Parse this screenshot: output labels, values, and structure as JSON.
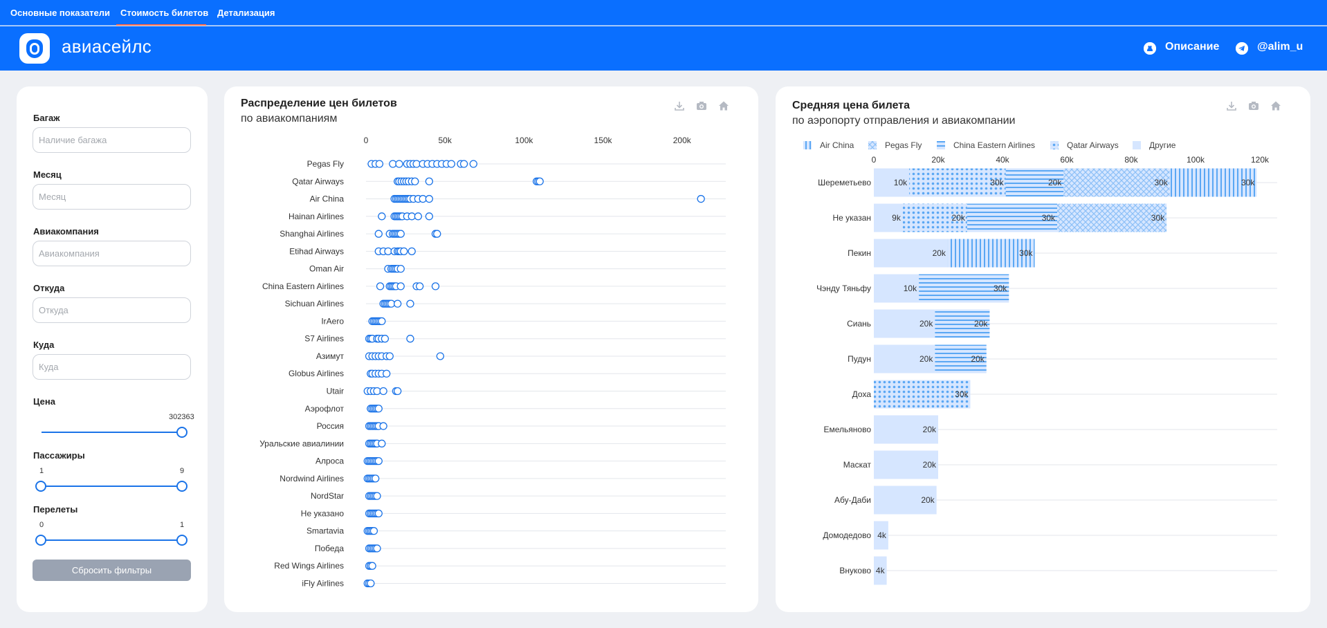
{
  "nav": {
    "tabs": [
      {
        "label": "Основные показатели"
      },
      {
        "label": "Стоимость билетов"
      },
      {
        "label": "Детализация"
      }
    ]
  },
  "header": {
    "brand": "авиасейлс",
    "link_description": "Описание",
    "link_telegram": "@alim_u"
  },
  "filters": {
    "baggage": {
      "label": "Багаж",
      "placeholder": "Наличие багажа"
    },
    "month": {
      "label": "Месяц",
      "placeholder": "Месяц"
    },
    "airline": {
      "label": "Авиакомпания",
      "placeholder": "Авиакомпания"
    },
    "from": {
      "label": "Откуда",
      "placeholder": "Откуда"
    },
    "to": {
      "label": "Куда",
      "placeholder": "Куда"
    },
    "price": {
      "label": "Цена",
      "max": "302363"
    },
    "passengers": {
      "label": "Пассажиры",
      "min": "1",
      "max": "9"
    },
    "transfers": {
      "label": "Перелеты",
      "min": "0",
      "max": "1"
    },
    "reset_label": "Сбросить фильтры"
  },
  "chart_left": {
    "title": "Распределение цен билетов",
    "subtitle": "по авиакомпаниям"
  },
  "chart_right": {
    "title": "Средняя цена билета",
    "subtitle": "по аэропорту отправления и авиакомпании"
  },
  "icons": {
    "download": "download-icon",
    "camera": "camera-icon",
    "home": "home-icon"
  },
  "colors": {
    "accent": "#0a6fff",
    "marker": "#1a73e8",
    "bar_fill": "#d6e6ff",
    "pattern": "#5aa7f4"
  },
  "chart_data": [
    {
      "type": "scatter",
      "x_ticks": [
        "0",
        "50k",
        "100k",
        "150k",
        "200k"
      ],
      "xlim": [
        0,
        215000
      ],
      "categories": [
        "Pegas Fly",
        "Qatar Airways",
        "Air China",
        "Hainan Airlines",
        "Shanghai Airlines",
        "Etihad Airways",
        "Oman Air",
        "China Eastern Airlines",
        "Sichuan Airlines",
        "IrAero",
        "S7 Airlines",
        "Азимут",
        "Globus Airlines",
        "Utair",
        "Аэрофлот",
        "Россия",
        "Уральские авиалинии",
        "Алроса",
        "Nordwind Airlines",
        "NordStar",
        "Не указано",
        "Smartavia",
        "Победа",
        "Red Wings Airlines",
        "iFly Airlines"
      ],
      "points": [
        [
          3500,
          6000,
          8500,
          17000,
          21000,
          26000,
          28000,
          30000,
          32000,
          36000,
          39000,
          42000,
          45000,
          48000,
          51000,
          54000,
          60000,
          62000,
          68000
        ],
        [
          20000,
          21000,
          22500,
          24000,
          25500,
          27000,
          29000,
          31000,
          40000,
          108000,
          109000,
          110000
        ],
        [
          18000,
          19000,
          20000,
          21000,
          22000,
          23000,
          24000,
          25000,
          26000,
          27000,
          28000,
          30000,
          33000,
          36000,
          40000,
          212000
        ],
        [
          10000,
          18000,
          19000,
          20000,
          21000,
          22000,
          23000,
          26000,
          29000,
          33000,
          40000
        ],
        [
          8000,
          15000,
          17000,
          18000,
          19000,
          20000,
          21000,
          22000,
          44000,
          45000
        ],
        [
          8000,
          11000,
          14000,
          18000,
          20000,
          21000,
          22000,
          24000,
          29000
        ],
        [
          14000,
          16000,
          17000,
          18000,
          19000,
          20000,
          22000
        ],
        [
          9000,
          15000,
          16000,
          17000,
          18000,
          19000,
          22000,
          32000,
          34000,
          44000
        ],
        [
          11000,
          12000,
          13000,
          14000,
          15000,
          16000,
          20000,
          28000
        ],
        [
          4000,
          5000,
          6000,
          7000,
          8000,
          9000,
          10000
        ],
        [
          2000,
          3000,
          4000,
          7000,
          8000,
          10000,
          12000,
          28000
        ],
        [
          2000,
          4000,
          6000,
          8000,
          10000,
          13000,
          15000,
          47000
        ],
        [
          3000,
          4000,
          6000,
          8000,
          10000,
          13000
        ],
        [
          1000,
          3000,
          5000,
          7000,
          11000,
          19000,
          20000
        ],
        [
          3000,
          4000,
          5000,
          6000,
          7000,
          8000
        ],
        [
          2000,
          3000,
          4000,
          5000,
          6000,
          7000,
          8000,
          11000
        ],
        [
          2000,
          3000,
          4000,
          5000,
          6000,
          7000,
          10000
        ],
        [
          1000,
          2000,
          3000,
          4000,
          5000,
          6000,
          7000,
          8000
        ],
        [
          1000,
          2000,
          3000,
          4000,
          5000,
          6000
        ],
        [
          2000,
          3000,
          4000,
          5000,
          6000,
          7000
        ],
        [
          2000,
          3000,
          4000,
          5000,
          6000,
          7000,
          8000
        ],
        [
          1000,
          2000,
          3000,
          4000,
          5000
        ],
        [
          2000,
          3000,
          4000,
          5000,
          6000,
          7000
        ],
        [
          2000,
          3000,
          4000
        ],
        [
          1000,
          2000,
          3000
        ]
      ]
    },
    {
      "type": "bar",
      "orientation": "horizontal",
      "stacked": true,
      "x_ticks": [
        "0",
        "20k",
        "40k",
        "60k",
        "80k",
        "100k",
        "120k"
      ],
      "xlim": [
        0,
        125000
      ],
      "legend": [
        "Air China",
        "Pegas Fly",
        "China Eastern Airlines",
        "Qatar Airways",
        "Другие"
      ],
      "legend_position": "top",
      "categories": [
        "Шереметьево",
        "Не указан",
        "Пекин",
        "Чэнду Тяньфу",
        "Сиань",
        "Пудун",
        "Доха",
        "Емельяново",
        "Маскат",
        "Абу-Даби",
        "Домодедово",
        "Внуково"
      ],
      "series": [
        {
          "name": "Другие",
          "values": [
            11000,
            9000,
            23000,
            14000,
            19000,
            19000,
            0,
            20000,
            20000,
            19500,
            4500,
            4000
          ]
        },
        {
          "name": "Qatar Airways",
          "values": [
            30000,
            20000,
            0,
            0,
            0,
            0,
            30000,
            0,
            0,
            0,
            0,
            0
          ]
        },
        {
          "name": "China Eastern Airlines",
          "values": [
            18000,
            28000,
            0,
            28000,
            17000,
            16000,
            0,
            0,
            0,
            0,
            0,
            0
          ]
        },
        {
          "name": "Pegas Fly",
          "values": [
            33000,
            34000,
            0,
            0,
            0,
            0,
            0,
            0,
            0,
            0,
            0,
            0
          ]
        },
        {
          "name": "Air China",
          "values": [
            27000,
            0,
            27000,
            0,
            0,
            0,
            0,
            0,
            0,
            0,
            0,
            0
          ]
        }
      ],
      "data_labels": [
        [
          "10k",
          "30k",
          "20k",
          "30k",
          "30k"
        ],
        [
          "9k",
          "20k",
          "30k",
          "30k"
        ],
        [
          "20k",
          "30k"
        ],
        [
          "10k",
          "30k"
        ],
        [
          "20k",
          "20k"
        ],
        [
          "20k",
          "20k"
        ],
        [
          "30k"
        ],
        [
          "20k"
        ],
        [
          "20k"
        ],
        [
          "20k"
        ],
        [
          "4k"
        ],
        [
          "4k"
        ]
      ]
    }
  ]
}
